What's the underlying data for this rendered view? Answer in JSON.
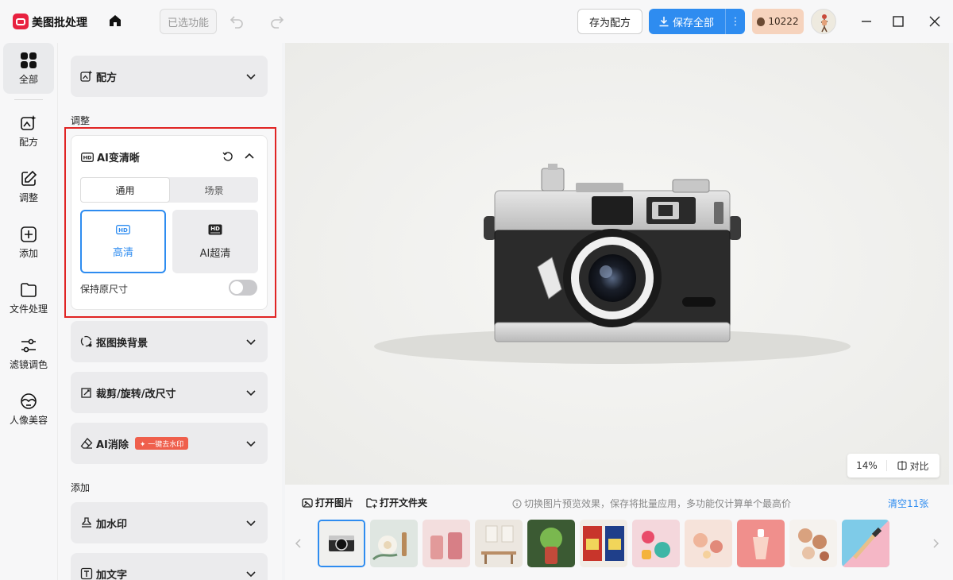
{
  "app": {
    "title": "美图批处理"
  },
  "toolbar": {
    "selected_features": "已选功能",
    "save_recipe": "存为配方",
    "save_all": "保存全部",
    "save_more": "⋮",
    "credits": "10222"
  },
  "nav": {
    "items": [
      {
        "label": "全部",
        "icon": "grid-icon",
        "active": true
      },
      {
        "label": "配方",
        "icon": "recipe-icon"
      },
      {
        "label": "调整",
        "icon": "edit-icon"
      },
      {
        "label": "添加",
        "icon": "add-icon"
      },
      {
        "label": "文件处理",
        "icon": "folder-icon"
      },
      {
        "label": "滤镜调色",
        "icon": "sliders-icon"
      },
      {
        "label": "人像美容",
        "icon": "face-icon"
      }
    ]
  },
  "panel": {
    "recipe": "配方",
    "adjust_section": "调整",
    "ai_clarity": {
      "title": "AI变清晰",
      "tabs": [
        "通用",
        "场景"
      ],
      "options": [
        "高清",
        "AI超清"
      ],
      "keep_size": "保持原尺寸",
      "keep_size_on": false
    },
    "cutout": "抠图换背景",
    "crop": "裁剪/旋转/改尺寸",
    "ai_erase": "AI消除",
    "ai_erase_badge": "✦ 一键去水印",
    "add_section": "添加",
    "watermark": "加水印",
    "text": "加文字"
  },
  "canvas": {
    "zoom": "14%",
    "compare": "对比"
  },
  "strip": {
    "open_image": "打开图片",
    "open_folder": "打开文件夹",
    "hint": "切换图片预览效果，保存将批量应用，多功能仅计算单个最高价",
    "clear": "清空11张"
  },
  "colors": {
    "accent": "#2e8cf0",
    "highlight_box": "#e02424",
    "badge": "#ef5f4c",
    "credits_bg": "#f6d3bd"
  }
}
